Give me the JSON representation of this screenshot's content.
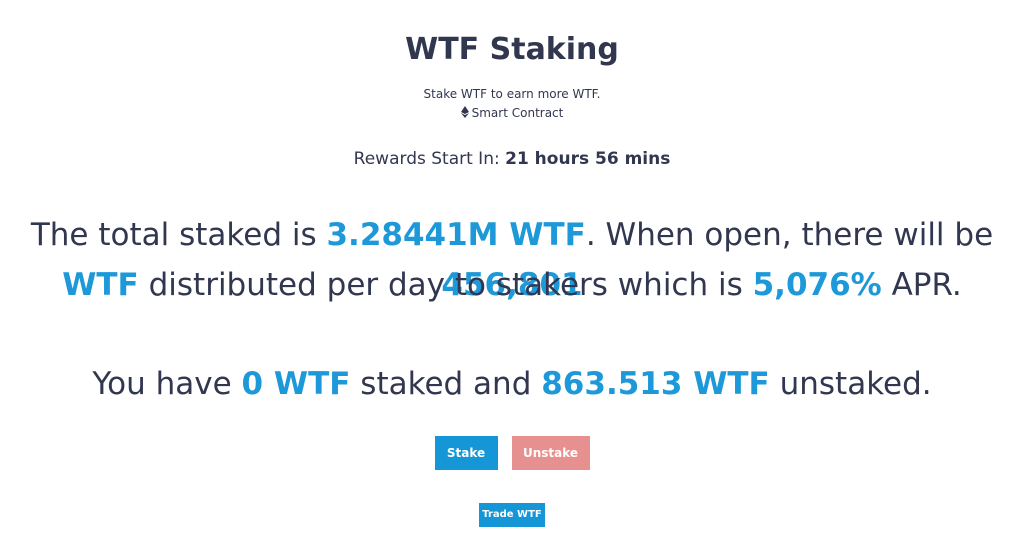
{
  "header": {
    "title": "WTF Staking",
    "subtitle": "Stake WTF to earn more WTF.",
    "contract_label": "Smart Contract",
    "contract_icon": "ethereum-icon"
  },
  "countdown": {
    "label": "Rewards Start In:",
    "value": "21 hours 56 mins"
  },
  "stats": {
    "line1_prefix": "The total staked is ",
    "total_staked": "3.28441M WTF",
    "line1_mid": ". When open, there will be ",
    "daily_amount": "456,801",
    "line2_token": "WTF",
    "line2_mid": " distributed per day to stakers which is ",
    "apr": "5,076%",
    "line2_suffix": " APR."
  },
  "user": {
    "prefix": "You have ",
    "staked": "0 WTF",
    "mid": " staked and ",
    "unstaked": "863.513 WTF",
    "suffix": " unstaked."
  },
  "actions": {
    "stake_label": "Stake",
    "unstake_label": "Unstake",
    "trade_label": "Trade WTF"
  },
  "colors": {
    "text": "#323750",
    "highlight": "#1d98d8",
    "primary_button": "#1596d6",
    "unstake_button": "#e6918f"
  }
}
